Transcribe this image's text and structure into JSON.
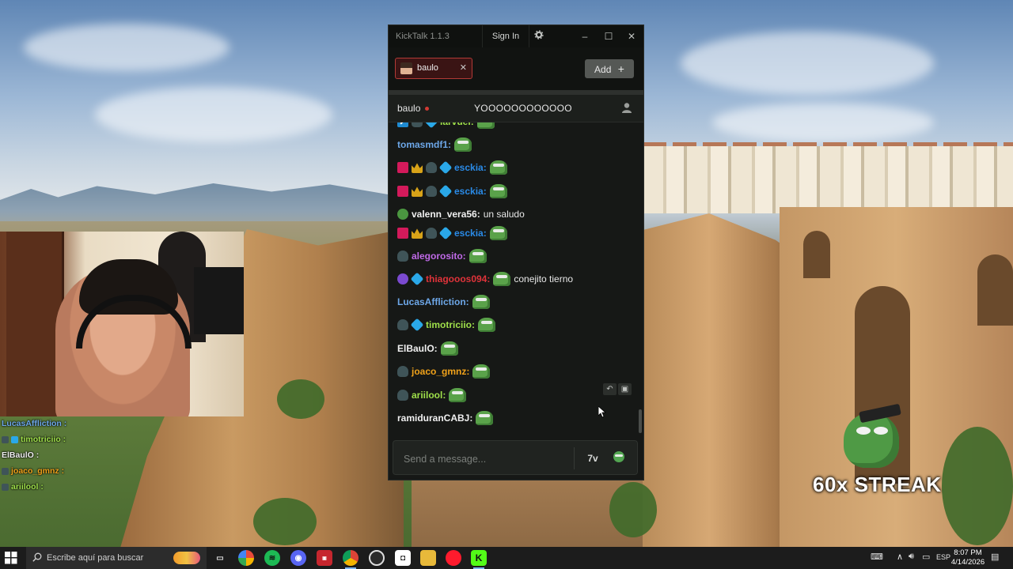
{
  "window": {
    "app_title": "KickTalk 1.1.3",
    "sign_in_label": "Sign In",
    "icons": [
      "gear-icon",
      "minimize-icon",
      "maximize-icon",
      "close-icon"
    ],
    "minimize_glyph": "–",
    "maximize_glyph": "☐",
    "close_glyph": "✕"
  },
  "tabs": [
    {
      "label": "baulo",
      "close_glyph": "✕"
    }
  ],
  "add_button": {
    "label": "Add",
    "glyph": "+"
  },
  "chat_header": {
    "channel": "baulo",
    "stream_title": "YOOOOOOOOOOOO"
  },
  "messages": [
    {
      "badges": [
        "b-mod",
        "b-cap",
        "b-gift"
      ],
      "username": "larvuel:",
      "color": "#9fe04a",
      "emotes": 1,
      "text": ""
    },
    {
      "badges": [],
      "username": "tomasmdf1:",
      "color": "#6da7e8",
      "emotes": 1,
      "text": ""
    },
    {
      "badges": [
        "b-kick",
        "b-crown",
        "b-cap",
        "b-gift"
      ],
      "username": "esckia:",
      "color": "#2a8be8",
      "emotes": 1,
      "text": ""
    },
    {
      "badges": [
        "b-kick",
        "b-crown",
        "b-cap",
        "b-gift"
      ],
      "username": "esckia:",
      "color": "#2a8be8",
      "emotes": 1,
      "text": ""
    },
    {
      "badges": [
        "b-frog"
      ],
      "username": "valenn_vera56:",
      "color": "#f0f0f0",
      "emotes": 0,
      "text": "un saludo"
    },
    {
      "badges": [
        "b-kick",
        "b-crown",
        "b-cap",
        "b-gift"
      ],
      "username": "esckia:",
      "color": "#2a8be8",
      "emotes": 1,
      "text": ""
    },
    {
      "badges": [
        "b-cap"
      ],
      "username": "alegorosito:",
      "color": "#c06ae8",
      "emotes": 1,
      "text": ""
    },
    {
      "badges": [
        "b-alien",
        "b-gift"
      ],
      "username": "thiagooos094:",
      "color": "#e0333a",
      "emotes": 1,
      "text": "conejito tierno"
    },
    {
      "badges": [],
      "username": "LucasAffliction:",
      "color": "#6da7e8",
      "emotes": 1,
      "text": ""
    },
    {
      "badges": [
        "b-cap",
        "b-gift"
      ],
      "username": "timotriciio:",
      "color": "#9fe04a",
      "emotes": 1,
      "text": ""
    },
    {
      "badges": [],
      "username": "ElBaulO:",
      "color": "#f0f0f0",
      "emotes": 1,
      "text": ""
    },
    {
      "badges": [
        "b-cap"
      ],
      "username": "joaco_gmnz:",
      "color": "#f0a21a",
      "emotes": 1,
      "text": ""
    },
    {
      "badges": [
        "b-cap"
      ],
      "username": "ariilool:",
      "color": "#9fe04a",
      "emotes": 1,
      "text": ""
    },
    {
      "badges": [],
      "username": "ramiduranCABJ:",
      "color": "#f0f0f0",
      "emotes": 1,
      "text": ""
    }
  ],
  "input": {
    "placeholder": "Send a message..."
  },
  "overlay_chat": [
    {
      "username": "LucasAffliction :",
      "color": "#6da7e8"
    },
    {
      "username": "timotriciio :",
      "color": "#9fe04a"
    },
    {
      "username": "ElBaulO :",
      "color": "#f0f0f0"
    },
    {
      "username": "joaco_gmnz :",
      "color": "#f0a21a"
    },
    {
      "username": "ariilool :",
      "color": "#9fe04a"
    }
  ],
  "streak": {
    "label": "60x STREAK"
  },
  "taskbar": {
    "search_placeholder": "Escribe aquí para buscar",
    "language": "ESP",
    "time": "8:07 PM",
    "date": "4/14/2026"
  },
  "colors": {
    "accent_red": "#b23a36",
    "window_bg": "#161816",
    "taskbar_bg": "#1c1c1c"
  }
}
